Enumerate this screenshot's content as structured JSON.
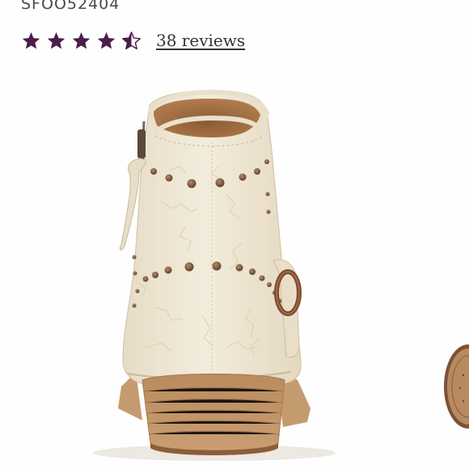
{
  "product": {
    "sku": "SFOO52404",
    "rating": 4.5,
    "rating_max": 5,
    "reviews_label": "38 reviews"
  },
  "icons": {
    "star": "star-icon",
    "half_star": "star-half-icon"
  },
  "colors": {
    "star": "#4a1e4a",
    "text": "#4a4a4a",
    "link": "#333333"
  },
  "image": {
    "alt": "Cream crackled leather studded ankle bootie, rear view"
  }
}
